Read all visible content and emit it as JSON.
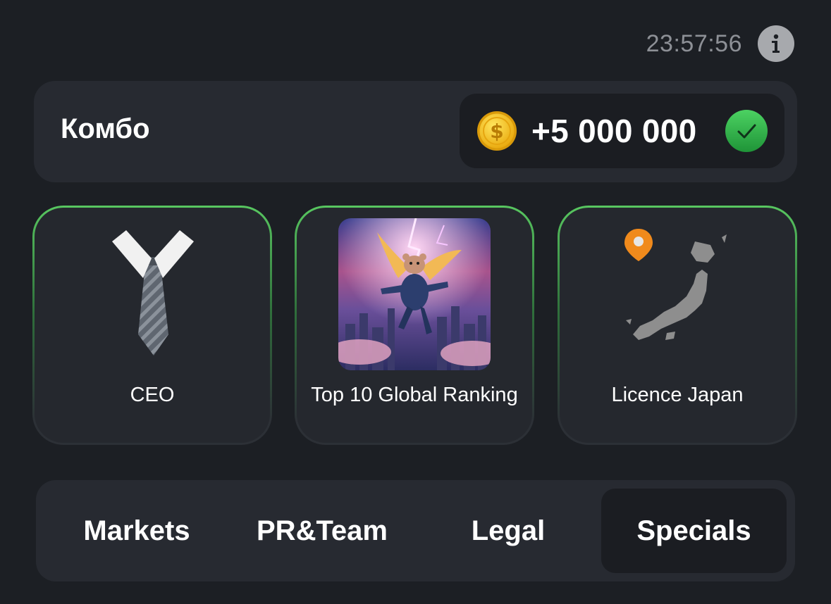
{
  "header": {
    "countdown": "23:57:56",
    "info_icon": "info-icon"
  },
  "combo": {
    "title": "Комбо",
    "reward": "+5 000 000",
    "coin_icon": "dollar-coin-icon",
    "status_icon": "green-check-icon",
    "colors": {
      "check": "#34b24a",
      "coin": "#f6c21c"
    }
  },
  "cards": [
    {
      "label": "CEO",
      "icon": "necktie-icon"
    },
    {
      "label": "Top 10 Global Ranking",
      "icon": "flying-hamster-image"
    },
    {
      "label": "Licence Japan",
      "icon": "japan-map-icon"
    }
  ],
  "tabs": [
    {
      "label": "Markets",
      "active": false
    },
    {
      "label": "PR&Team",
      "active": false
    },
    {
      "label": "Legal",
      "active": false
    },
    {
      "label": "Specials",
      "active": true
    }
  ],
  "colors": {
    "background": "#1c1f24",
    "panel": "#272a31",
    "card_border": "#58c760"
  }
}
